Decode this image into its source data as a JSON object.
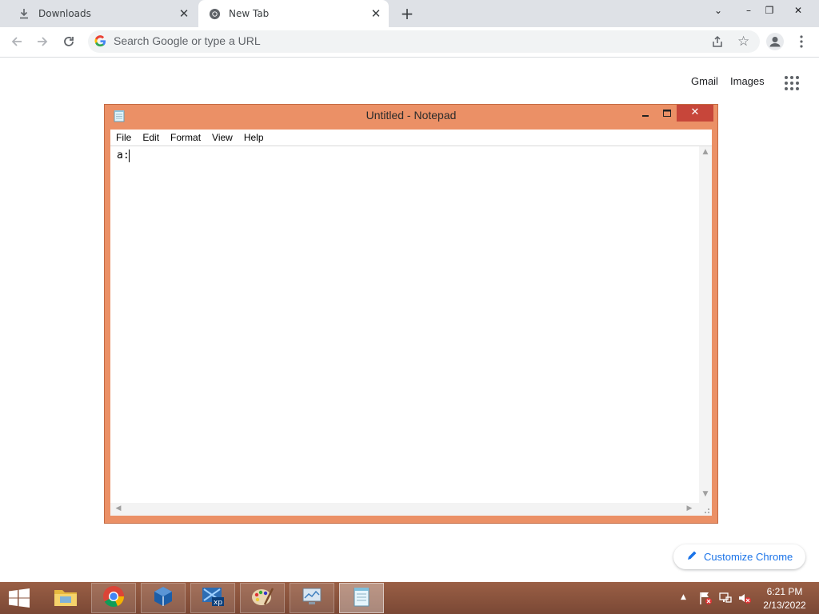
{
  "browser": {
    "tabs": [
      {
        "title": "Downloads",
        "icon": "download-icon"
      },
      {
        "title": "New Tab",
        "icon": "chrome-icon"
      }
    ],
    "omnibox_placeholder": "Search Google or type a URL",
    "ntp": {
      "links": [
        "Gmail",
        "Images"
      ],
      "customize_label": "Customize Chrome"
    }
  },
  "notepad": {
    "title": "Untitled - Notepad",
    "menu": [
      "File",
      "Edit",
      "Format",
      "View",
      "Help"
    ],
    "content": "a:"
  },
  "taskbar": {
    "apps": [
      "file-explorer-icon",
      "chrome-icon",
      "virtualbox-icon",
      "xp-mode-icon",
      "paint-icon",
      "monitor-icon",
      "notepad-icon"
    ],
    "time": "6:21 PM",
    "date": "2/13/2022"
  },
  "colors": {
    "notepad_frame": "#eb9066",
    "close_button": "#c7463a",
    "taskbar": "#8a5440",
    "link_blue": "#1a73e8"
  }
}
